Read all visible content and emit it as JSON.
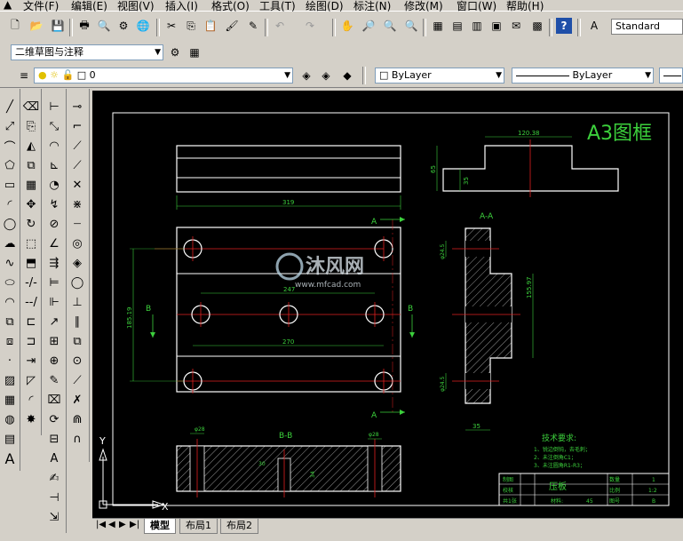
{
  "menu": {
    "items": [
      "文件(F)",
      "编辑(E)",
      "视图(V)",
      "插入(I)",
      "格式(O)",
      "工具(T)",
      "绘图(D)",
      "标注(N)",
      "修改(M)",
      "窗口(W)",
      "帮助(H)"
    ]
  },
  "toolbar": {
    "style_value": "Standard",
    "workspace_value": "二维草图与注释",
    "layer_value": "0",
    "color_value": "ByLayer",
    "linetype_value": "ByLayer"
  },
  "drawing": {
    "frame_title": "A3图框",
    "section_aa": "A-A",
    "section_bb": "B-B",
    "label_a_top": "A",
    "label_a_bottom": "A",
    "label_b_left": "B",
    "label_b_right": "B",
    "dim_319": "319",
    "dim_247": "247",
    "dim_270": "270",
    "dim_18519": "185.19",
    "dim_12038": "120.38",
    "dim_65": "65",
    "dim_35": "35",
    "dim_phi245_top": "φ24.5",
    "dim_phi245_bottom": "φ24.5",
    "dim_15597": "155.97",
    "dim_35_bottom": "35",
    "dim_phi28_left": "φ28",
    "dim_phi28_right": "φ28",
    "dim_30": "30",
    "dim_34": "34",
    "tech_title": "技术要求:",
    "tech_lines": [
      "1、锐边倒钝，去毛刺；",
      "2、未注倒角C1；",
      "3、未注圆角R1-R3；"
    ],
    "part_name": "压板",
    "tb_zhitu": "制图",
    "tb_jiaohe": "校核",
    "tb_qty_label": "数量",
    "tb_qty": "1",
    "tb_scale_label": "比例",
    "tb_scale": "1:2",
    "tb_sheet_label": "图号",
    "tb_sheet": "B",
    "tb_material_label": "材料:",
    "tb_material": "45",
    "tb_pages": "共1张"
  },
  "watermark": {
    "brand": "沐风网",
    "url": "www.mfcad.com"
  },
  "ucs": {
    "x": "X",
    "y": "Y"
  },
  "layout_tabs": [
    "模型",
    "布局1",
    "布局2"
  ]
}
